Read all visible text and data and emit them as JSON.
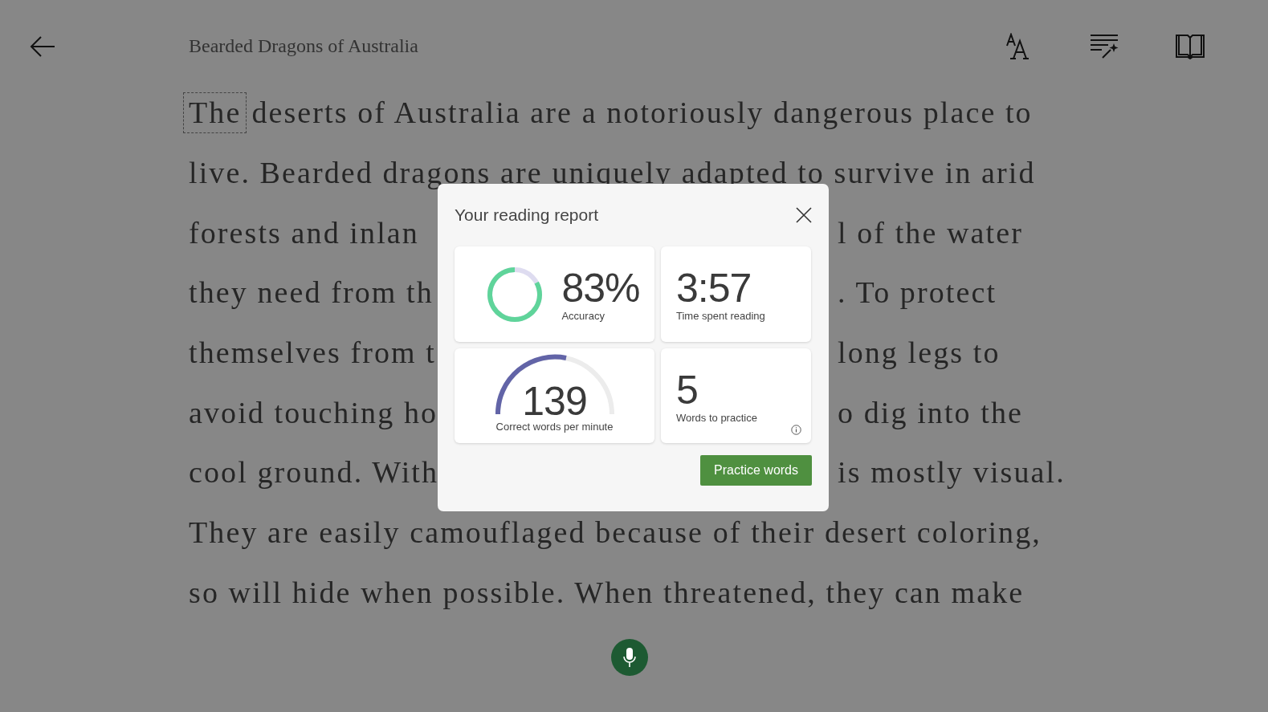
{
  "header": {
    "title": "Bearded Dragons of Australia"
  },
  "passage": {
    "lines": [
      {
        "focus_word": "The",
        "text": "deserts of Australia are a notoriously dangerous place to"
      },
      {
        "text": "live. Bearded dragons are uniquely adapted to survive in arid"
      },
      {
        "text": "forests and inlan",
        "after_dialog": "l of the water"
      },
      {
        "text": "they need from th",
        "after_dialog": ". To protect"
      },
      {
        "text": "themselves from t",
        "after_dialog": "long legs to"
      },
      {
        "text": "avoid touching ho",
        "after_dialog": "o dig into the"
      },
      {
        "text": "cool ground. With",
        "after_dialog": "is mostly visual."
      },
      {
        "text": "They are easily camouflaged because of their desert coloring,"
      },
      {
        "text": "so will hide when possible. When threatened, they can make"
      }
    ]
  },
  "dialog": {
    "title": "Your reading report",
    "stats": [
      {
        "kind": "ring",
        "value": "83%",
        "label": "Accuracy",
        "level": 0.83
      },
      {
        "kind": "plain",
        "value": "3:57",
        "label": "Time spent reading"
      },
      {
        "kind": "gauge",
        "value": "139",
        "label": "Correct words per minute"
      },
      {
        "kind": "info",
        "value": "5",
        "label": "Words to practice"
      }
    ],
    "button": "Practice words"
  }
}
